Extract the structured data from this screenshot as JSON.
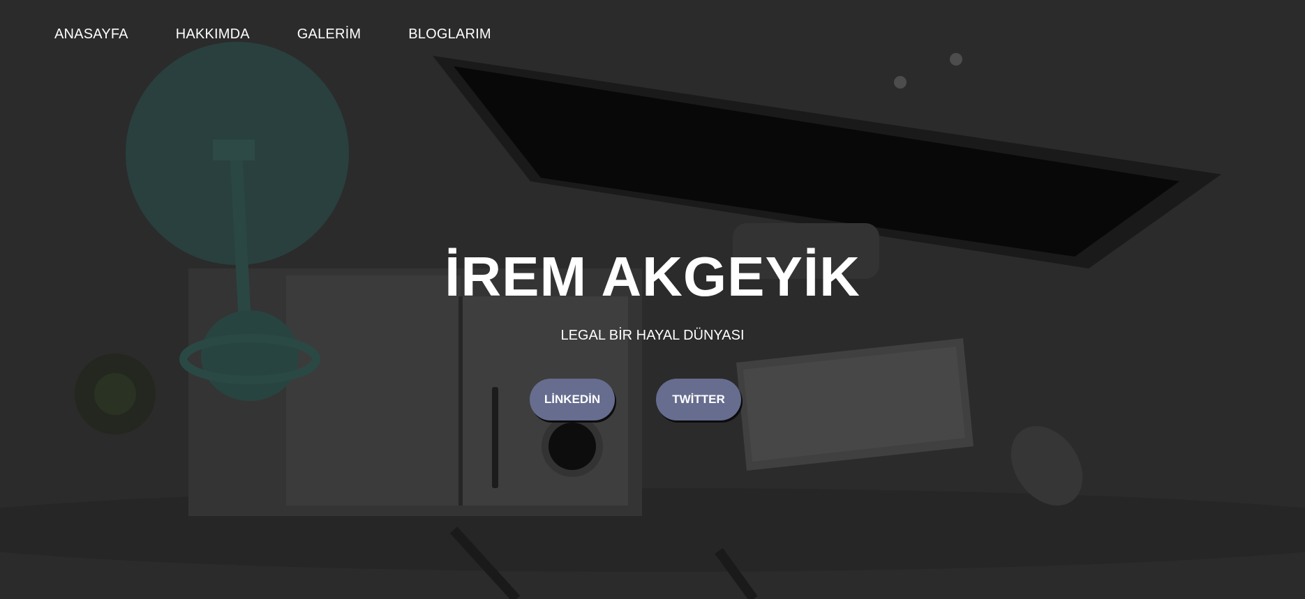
{
  "nav": {
    "items": [
      {
        "label": "ANASAYFA"
      },
      {
        "label": "HAKKIMDA"
      },
      {
        "label": "GALERİM"
      },
      {
        "label": "BLOGLARIM"
      }
    ]
  },
  "hero": {
    "title": "İREM AKGEYİK",
    "subtitle": "LEGAL BİR HAYAL DÜNYASI",
    "buttons": {
      "linkedin": "LİNKEDİN",
      "twitter": "TWİTTER"
    }
  },
  "colors": {
    "button_bg": "#676d8f",
    "text": "#ffffff",
    "background": "#2e2e2e"
  }
}
